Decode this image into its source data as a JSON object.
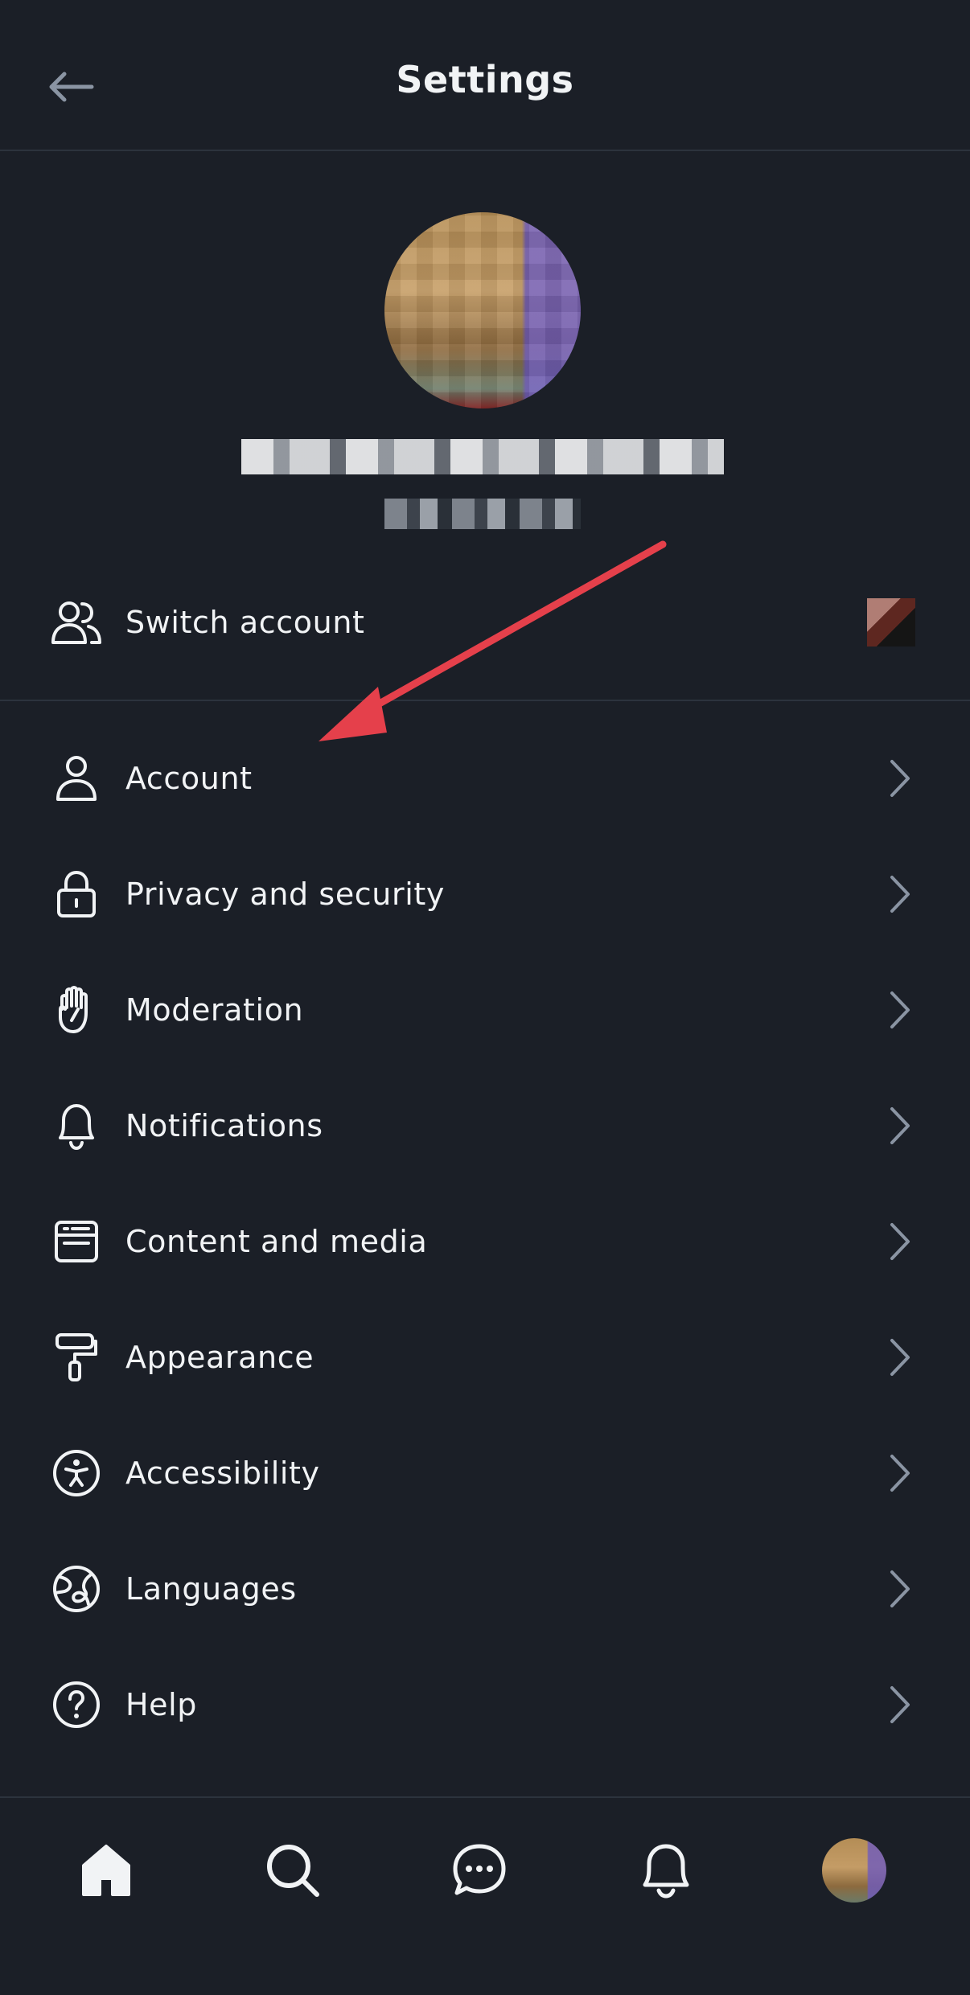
{
  "header": {
    "title": "Settings"
  },
  "profile": {
    "display_name": "",
    "handle": ""
  },
  "switch_account": {
    "label": "Switch account"
  },
  "menu": [
    {
      "label": "Account",
      "icon": "person-icon"
    },
    {
      "label": "Privacy and security",
      "icon": "lock-icon"
    },
    {
      "label": "Moderation",
      "icon": "hand-icon"
    },
    {
      "label": "Notifications",
      "icon": "bell-icon"
    },
    {
      "label": "Content and media",
      "icon": "browser-window-icon"
    },
    {
      "label": "Appearance",
      "icon": "paint-roller-icon"
    },
    {
      "label": "Accessibility",
      "icon": "accessibility-icon"
    },
    {
      "label": "Languages",
      "icon": "globe-icon"
    },
    {
      "label": "Help",
      "icon": "question-circle-icon"
    }
  ],
  "tabbar": [
    "home-icon",
    "search-icon",
    "chat-icon",
    "bell-icon",
    "profile-avatar"
  ],
  "colors": {
    "background": "#1b1f27",
    "divider": "#2c333d",
    "text": "#f1f3f5",
    "chevron": "#8a94a3",
    "annotation_arrow": "#e5404b"
  }
}
